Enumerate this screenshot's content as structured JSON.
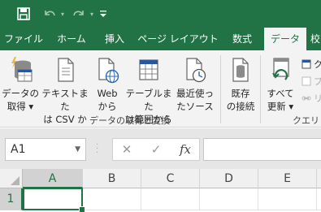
{
  "colors": {
    "brand": "#217346",
    "ribbon": "#f3f3f3"
  },
  "quick_access": [
    {
      "name": "save-icon"
    },
    {
      "name": "undo-icon"
    },
    {
      "name": "redo-icon"
    },
    {
      "name": "customize-qat-icon"
    }
  ],
  "tabs": [
    {
      "label": "ファイル"
    },
    {
      "label": "ホーム"
    },
    {
      "label": "挿入"
    },
    {
      "label": "ページ レイアウト"
    },
    {
      "label": "数式"
    },
    {
      "label": "データ",
      "active": true
    },
    {
      "label": "校"
    }
  ],
  "ribbon": {
    "get_data": {
      "label": "データの\n取得 ▾",
      "icon": "database-icon"
    },
    "from_text": {
      "label": "テキストまた\nは CSV から",
      "icon": "text-file-icon"
    },
    "from_web": {
      "label": "Web\nから",
      "icon": "web-icon"
    },
    "from_table": {
      "label": "テーブルまた\nは範囲から",
      "icon": "table-icon"
    },
    "recent_sources": {
      "label": "最近使っ\nたソース",
      "icon": "recent-clock-icon"
    },
    "existing_connections": {
      "label": "既存\nの接続",
      "icon": "connections-icon"
    },
    "refresh_all": {
      "label": "すべて\n更新 ▾",
      "icon": "refresh-icon"
    },
    "group_get_transform": "データの取得と変換",
    "group_queries": "クエリと接",
    "small_items": [
      "ク",
      "プ",
      "リ"
    ]
  },
  "formula_bar": {
    "name_box": "A1",
    "cancel": "✕",
    "enter": "✓",
    "fx": "fx",
    "value": ""
  },
  "grid": {
    "columns": [
      "A",
      "B",
      "C",
      "D",
      "E"
    ],
    "rows": [
      "1"
    ],
    "active_cell": "A1"
  }
}
